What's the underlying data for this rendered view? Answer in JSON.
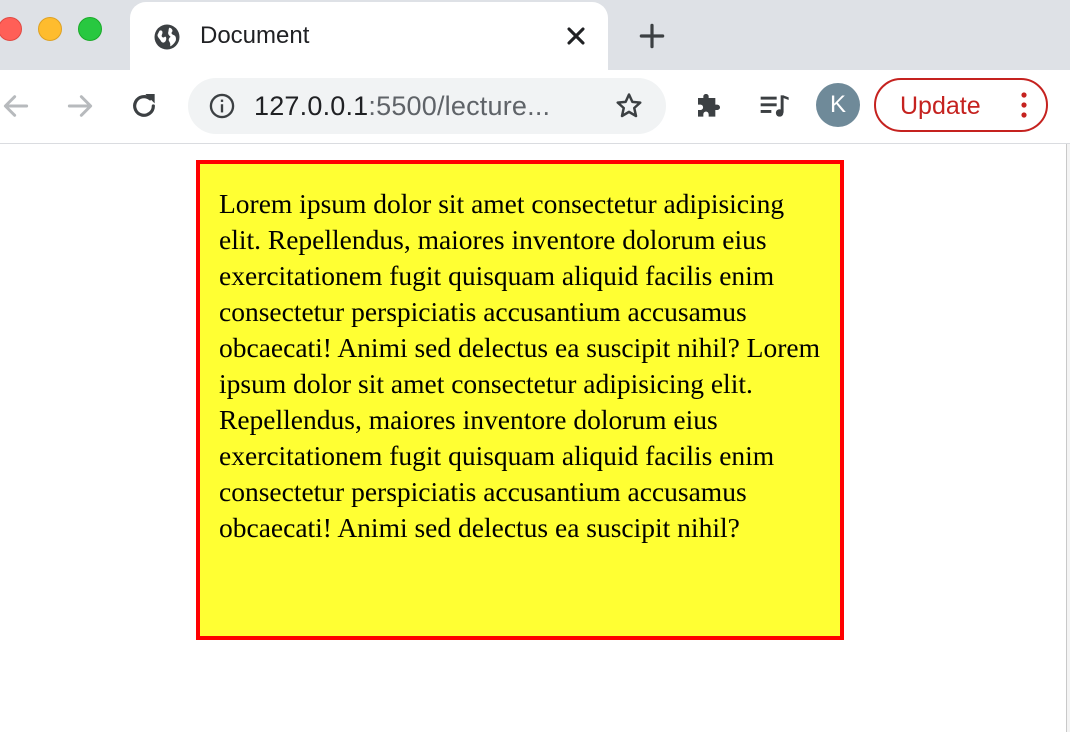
{
  "browser": {
    "tab": {
      "title": "Document"
    },
    "address_bar": {
      "host": "127.0.0.1",
      "rest": ":5500/lecture..."
    },
    "profile": {
      "initial": "K"
    },
    "update_button": {
      "label": "Update"
    },
    "colors": {
      "tabstrip": "#dee1e6",
      "update_accent": "#c5221f",
      "avatar": "#6f8a99"
    },
    "icons": {
      "back": "arrow-left-icon",
      "forward": "arrow-right-icon",
      "reload": "reload-icon",
      "info": "info-icon",
      "bookmark": "star-icon",
      "extensions": "puzzle-icon",
      "media": "media-queue-icon",
      "tab_favicon": "globe-icon",
      "close": "close-icon",
      "new_tab": "plus-icon",
      "menu": "vertical-dots-icon"
    }
  },
  "page": {
    "box": {
      "text": "Lorem ipsum dolor sit amet consectetur adipisicing elit. Repellendus, maiores inventore dolorum eius exercitationem fugit quisquam aliquid facilis enim consectetur perspiciatis accusantium accusamus obcaecati! Animi sed delectus ea suscipit nihil? Lorem ipsum dolor sit amet consectetur adipisicing elit. Repellendus, maiores inventore dolorum eius exercitationem fugit quisquam aliquid facilis enim consectetur perspiciatis accusantium accusamus obcaecati! Animi sed delectus ea suscipit nihil?",
      "background": "#ffff33",
      "border": "#ff0000"
    }
  }
}
